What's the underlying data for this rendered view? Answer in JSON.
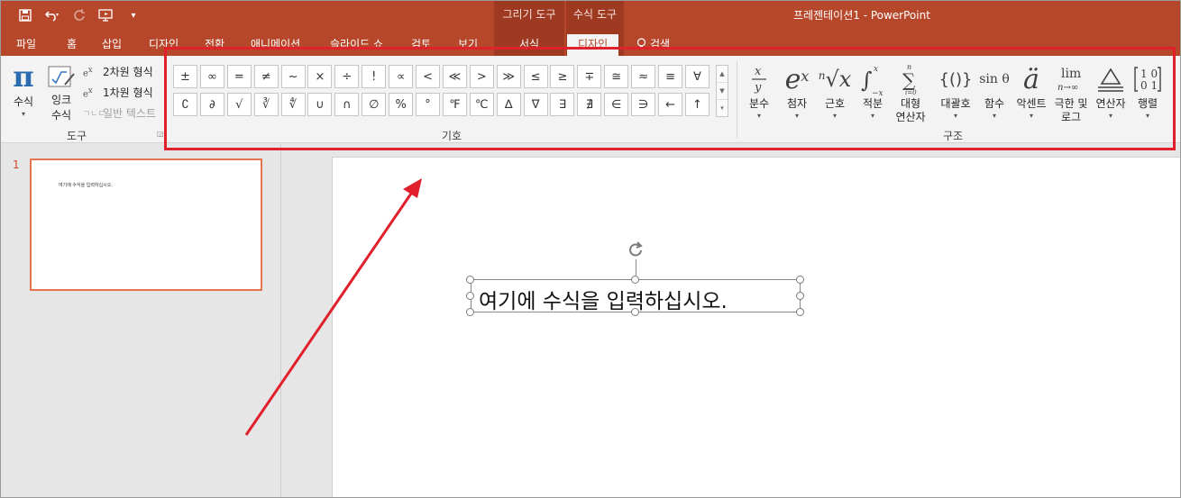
{
  "window": {
    "title": "프레젠테이션1  -  PowerPoint"
  },
  "context_groups": {
    "drawing_tools": "그리기 도구",
    "equation_tools": "수식 도구"
  },
  "tabs": [
    "파일",
    "홈",
    "삽입",
    "디자인",
    "전환",
    "애니메이션",
    "슬라이드 쇼",
    "검토",
    "보기",
    "서식",
    "디자인"
  ],
  "tell_me": "검색",
  "tools_group": {
    "label": "도구",
    "equation_button": "수식",
    "ink_equation_line1": "잉크",
    "ink_equation_line2": "수식",
    "professional": "2차원 형식",
    "linear": "1차원 형식",
    "normal_text": "일반 텍스트"
  },
  "symbols_group": {
    "label": "기호",
    "row1": [
      "±",
      "∞",
      "=",
      "≠",
      "~",
      "×",
      "÷",
      "!",
      "∝",
      "<",
      "≪",
      ">",
      "≫",
      "≤",
      "≥",
      "∓",
      "≅",
      "≈",
      "≡",
      "∀"
    ],
    "row2": [
      "∁",
      "∂",
      "√",
      "∛",
      "∜",
      "∪",
      "∩",
      "∅",
      "%",
      "°",
      "℉",
      "℃",
      "∆",
      "∇",
      "∃",
      "∄",
      "∈",
      "∋",
      "←",
      "↑"
    ]
  },
  "structures_group": {
    "label": "구조",
    "fraction": "분수",
    "script": "첨자",
    "radical": "근호",
    "integral": "적분",
    "large_operator_line1": "대형",
    "large_operator_line2": "연산자",
    "bracket": "대괄호",
    "function": "함수",
    "accent": "악센트",
    "limit_log_line1": "극한 및",
    "limit_log_line2": "로그",
    "operator": "연산자",
    "matrix": "행렬"
  },
  "slides": {
    "number": "1",
    "thumb_text": "여기에 수식을 입력하십시오."
  },
  "equation_placeholder": "여기에 수식을 입력하십시오.",
  "colors": {
    "accent": "#b7472a",
    "highlight": "#e0202b",
    "thumb_border": "#e8734f"
  }
}
